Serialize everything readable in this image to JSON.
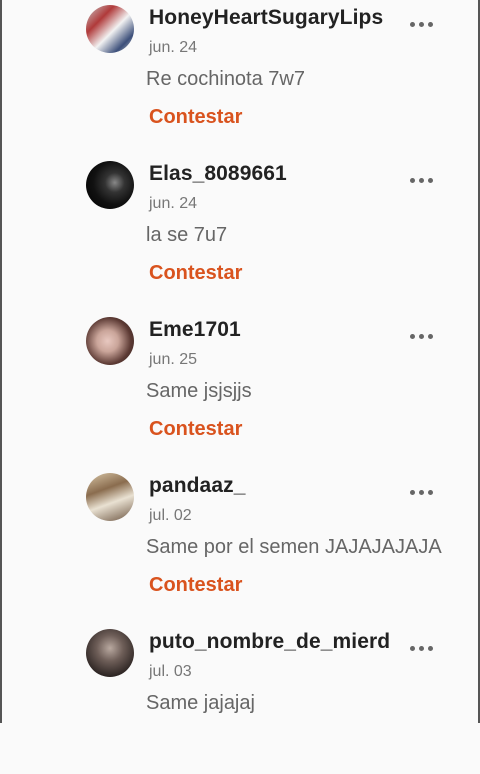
{
  "colors": {
    "accent": "#d9531e",
    "background": "#fafafa",
    "username": "#222222",
    "meta": "#777777"
  },
  "comments": [
    {
      "username": "HoneyHeartSugaryLips",
      "date": "jun. 24",
      "text": "Re cochinota 7w7",
      "reply_label": "Contestar",
      "avatar_icon": "profile-photo",
      "more_icon": "more-dots-icon"
    },
    {
      "username": "Elas_8089661",
      "date": "jun. 24",
      "text": "la se 7u7",
      "reply_label": "Contestar",
      "avatar_icon": "profile-photo",
      "more_icon": "more-dots-icon"
    },
    {
      "username": "Eme1701",
      "date": "jun. 25",
      "text": "Same jsjsjjs",
      "reply_label": "Contestar",
      "avatar_icon": "profile-photo",
      "more_icon": "more-dots-icon"
    },
    {
      "username": "pandaaz_",
      "date": "jul. 02",
      "text": "Same por el semen JAJAJAJAJA",
      "reply_label": "Contestar",
      "avatar_icon": "profile-photo",
      "more_icon": "more-dots-icon"
    },
    {
      "username": "puto_nombre_de_mierd",
      "date": "jul. 03",
      "text": "Same jajajaj",
      "reply_label": "",
      "avatar_icon": "profile-photo",
      "more_icon": "more-dots-icon"
    }
  ]
}
